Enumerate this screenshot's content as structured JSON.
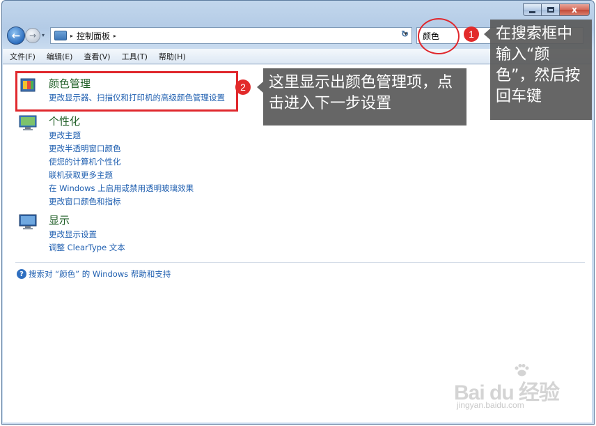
{
  "window": {
    "caption": {
      "minimize": "",
      "maximize": "",
      "close": "x"
    }
  },
  "address": {
    "path_separator": "▸",
    "breadcrumb": "控制面板",
    "trailing_separator": "▸",
    "dropdown": "▾"
  },
  "search": {
    "value": "颜色"
  },
  "menu": [
    "文件(F)",
    "编辑(E)",
    "查看(V)",
    "工具(T)",
    "帮助(H)"
  ],
  "results": [
    {
      "title": "颜色管理",
      "icon": "color-management-icon",
      "links": [
        "更改显示器、扫描仪和打印机的高级颜色管理设置"
      ]
    },
    {
      "title": "个性化",
      "icon": "personalization-icon",
      "links": [
        "更改主题",
        "更改半透明窗口颜色",
        "使您的计算机个性化",
        "联机获取更多主题",
        "在 Windows 上启用或禁用透明玻璃效果",
        "更改窗口颜色和指标"
      ]
    },
    {
      "title": "显示",
      "icon": "display-icon",
      "links": [
        "更改显示设置",
        "调整 ClearType 文本"
      ]
    }
  ],
  "help": {
    "icon": "help-icon",
    "text": "搜索对 “颜色” 的 Windows 帮助和支持"
  },
  "annotations": {
    "badge1": "1",
    "badge2": "2",
    "callout1": "在搜索框中输入“颜色”，然后按回车键",
    "callout2": "这里显示出颜色管理项，点击进入下一步设置",
    "accent_color": "#e0282d"
  },
  "watermark": {
    "brand": "Bai du 经验",
    "url": "jingyan.baidu.com"
  }
}
